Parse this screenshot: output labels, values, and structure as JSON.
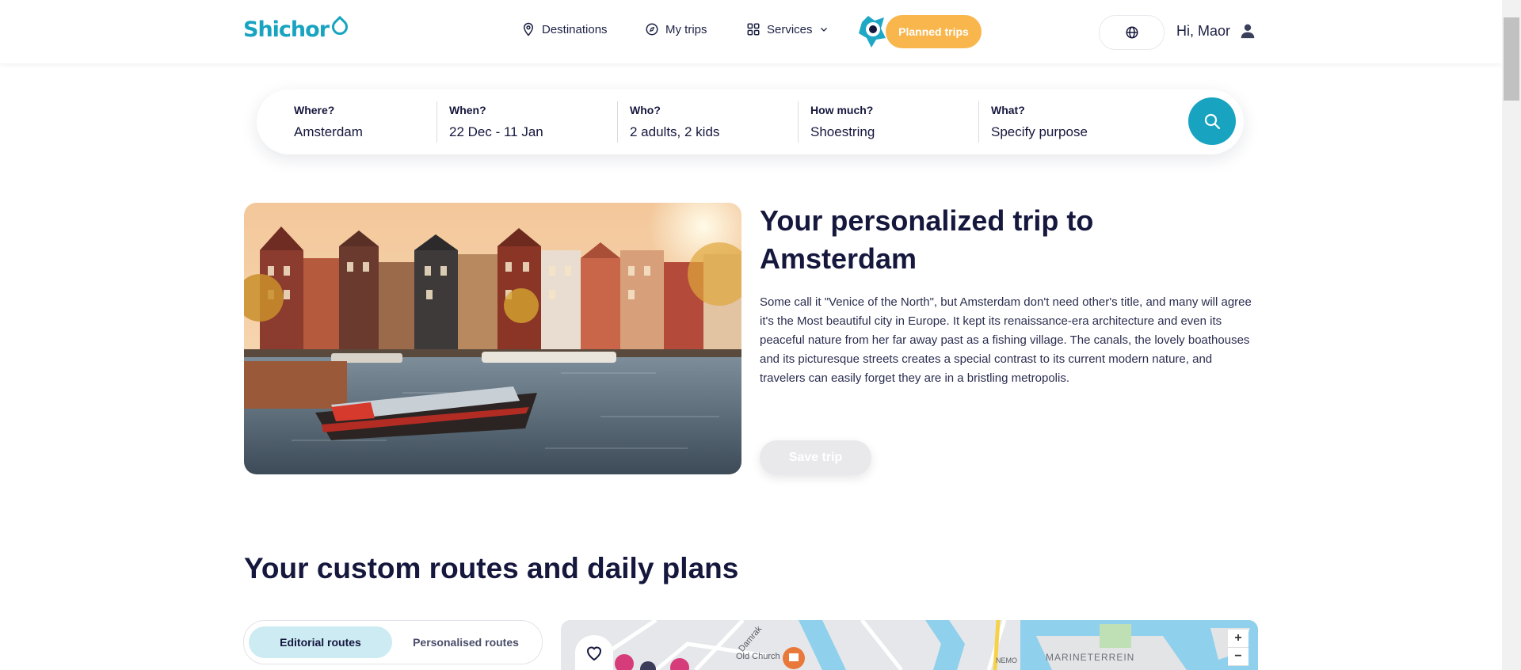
{
  "header": {
    "logo_text": "Shichor",
    "nav": [
      {
        "label": "Destinations",
        "icon": "map-pin-icon"
      },
      {
        "label": "My trips",
        "icon": "compass-icon"
      },
      {
        "label": "Services",
        "icon": "grid-icon"
      }
    ],
    "planned_trips_label": "Planned trips",
    "greeting": "Hi, Maor",
    "accent_color": "#18a4c1",
    "planned_color": "#f9b64d"
  },
  "search": {
    "fields": [
      {
        "label": "Where?",
        "value": "Amsterdam"
      },
      {
        "label": "When?",
        "value": "22 Dec - 11 Jan"
      },
      {
        "label": "Who?",
        "value": "2 adults, 2 kids"
      },
      {
        "label": "How much?",
        "value": "Shoestring"
      },
      {
        "label": "What?",
        "value": "Specify purpose"
      }
    ]
  },
  "hero": {
    "title": "Your personalized trip to Amsterdam",
    "description": "Some call it \"Venice of the North\", but Amsterdam don't need other's title, and many will agree it's the Most beautiful city in Europe. It kept its renaissance-era architecture and even its peaceful nature from her far away past as a fishing village. The canals, the lovely boathouses and its picturesque streets creates a special contrast to its current modern nature, and travelers can easily forget they are in a bristling metropolis.",
    "save_label": "Save trip"
  },
  "routes": {
    "section_title": "Your custom routes and daily plans",
    "tabs": [
      {
        "label": "Editorial routes",
        "active": true
      },
      {
        "label": "Personalised routes",
        "active": false
      }
    ]
  },
  "map": {
    "labels": [
      "Old Church",
      "NEMO",
      "MARINETERREIN",
      "Damrak"
    ],
    "zoom_in": "+",
    "zoom_out": "−"
  }
}
